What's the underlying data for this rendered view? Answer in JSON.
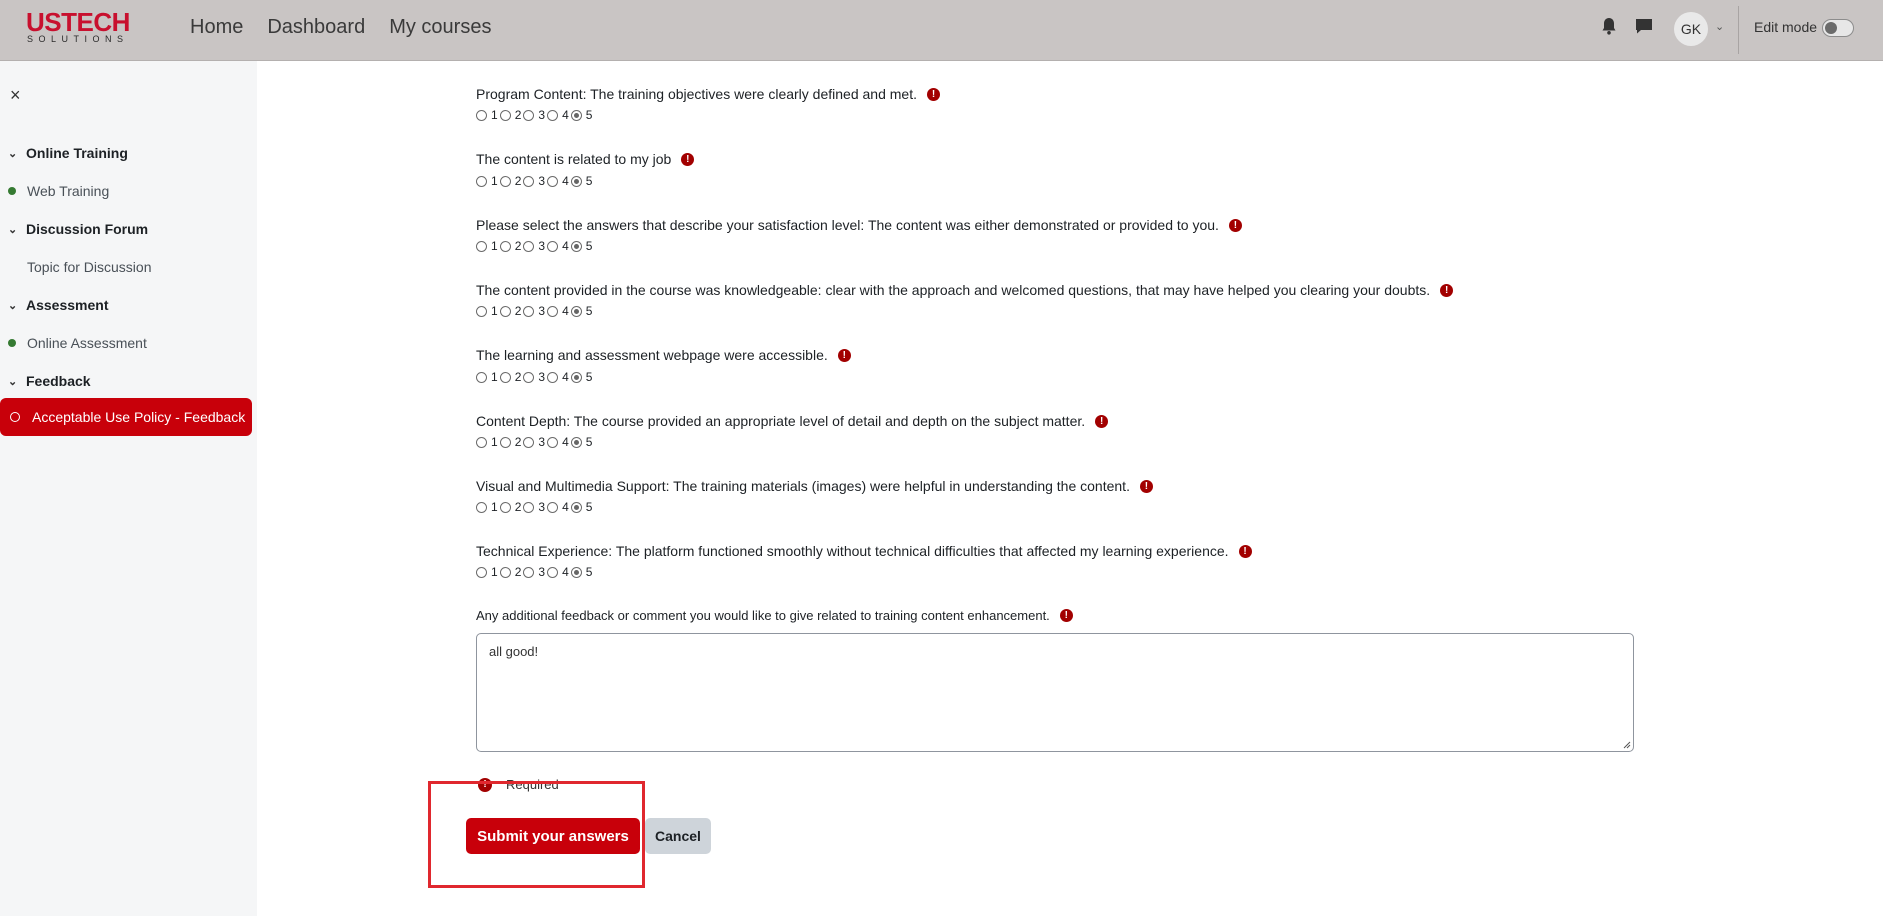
{
  "brand": {
    "logo_top": "USTECH",
    "logo_bottom": "SOLUTIONS"
  },
  "nav": {
    "links": [
      "Home",
      "Dashboard",
      "My courses"
    ]
  },
  "user": {
    "initials": "GK"
  },
  "edit_mode": {
    "label": "Edit mode",
    "enabled": false
  },
  "sidebar": {
    "close": "×",
    "sections": [
      {
        "title": "Online Training",
        "items": [
          {
            "label": "Web Training",
            "status": "complete"
          }
        ]
      },
      {
        "title": "Discussion Forum",
        "items": [
          {
            "label": "Topic for Discussion",
            "status": "none"
          }
        ]
      },
      {
        "title": "Assessment",
        "items": [
          {
            "label": "Online Assessment",
            "status": "complete"
          }
        ]
      },
      {
        "title": "Feedback",
        "items": [
          {
            "label": "Acceptable Use Policy - Feedback",
            "status": "active"
          }
        ]
      }
    ]
  },
  "questions": [
    {
      "text": "Program Content: The training objectives were clearly defined and met.",
      "selected": 5
    },
    {
      "text": "The content is related to my job",
      "selected": 5
    },
    {
      "text": "Please select the answers that describe your satisfaction level: The content was either demonstrated or provided to you.",
      "selected": 5
    },
    {
      "text": "The content provided in the course was knowledgeable: clear with the approach and welcomed questions, that may have helped you clearing your doubts.",
      "selected": 5
    },
    {
      "text": "The learning and assessment webpage were accessible.",
      "selected": 5
    },
    {
      "text": "Content Depth: The course provided an appropriate level of detail and depth on the subject matter.",
      "selected": 5
    },
    {
      "text": "Visual and Multimedia Support: The training materials (images) were helpful in understanding the content.",
      "selected": 5
    },
    {
      "text": "Technical Experience: The platform functioned smoothly without technical difficulties that affected my learning experience.",
      "selected": 5
    }
  ],
  "rating_options": [
    "1",
    "2",
    "3",
    "4",
    "5"
  ],
  "comment": {
    "label": "Any additional feedback or comment you would like to give related to training content enhancement.",
    "value": "all good!"
  },
  "required_note": "Required",
  "actions": {
    "submit": "Submit your answers",
    "cancel": "Cancel"
  },
  "colors": {
    "brand_red": "#c8000a",
    "required_red": "#a20000",
    "complete_green": "#357a32",
    "navbar_bg": "#c9c5c4"
  }
}
